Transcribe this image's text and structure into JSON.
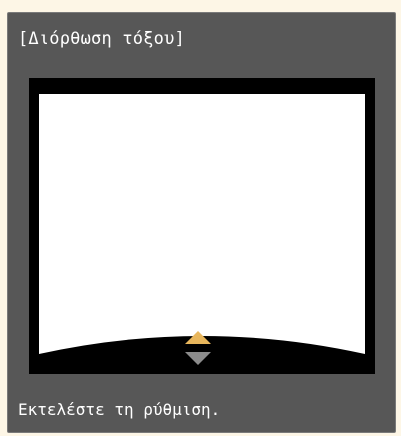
{
  "dialog": {
    "title": "[Διόρθωση τόξου]",
    "message": "Εκτελέστε τη ρύθμιση."
  },
  "colors": {
    "background": "#fdf6e6",
    "panel": "#575757",
    "screen": "#ffffff",
    "up_arrow": "#e8b65c",
    "down_arrow": "#8c8c8c"
  },
  "icons": {
    "up": "triangle-up-icon",
    "down": "triangle-down-icon"
  }
}
